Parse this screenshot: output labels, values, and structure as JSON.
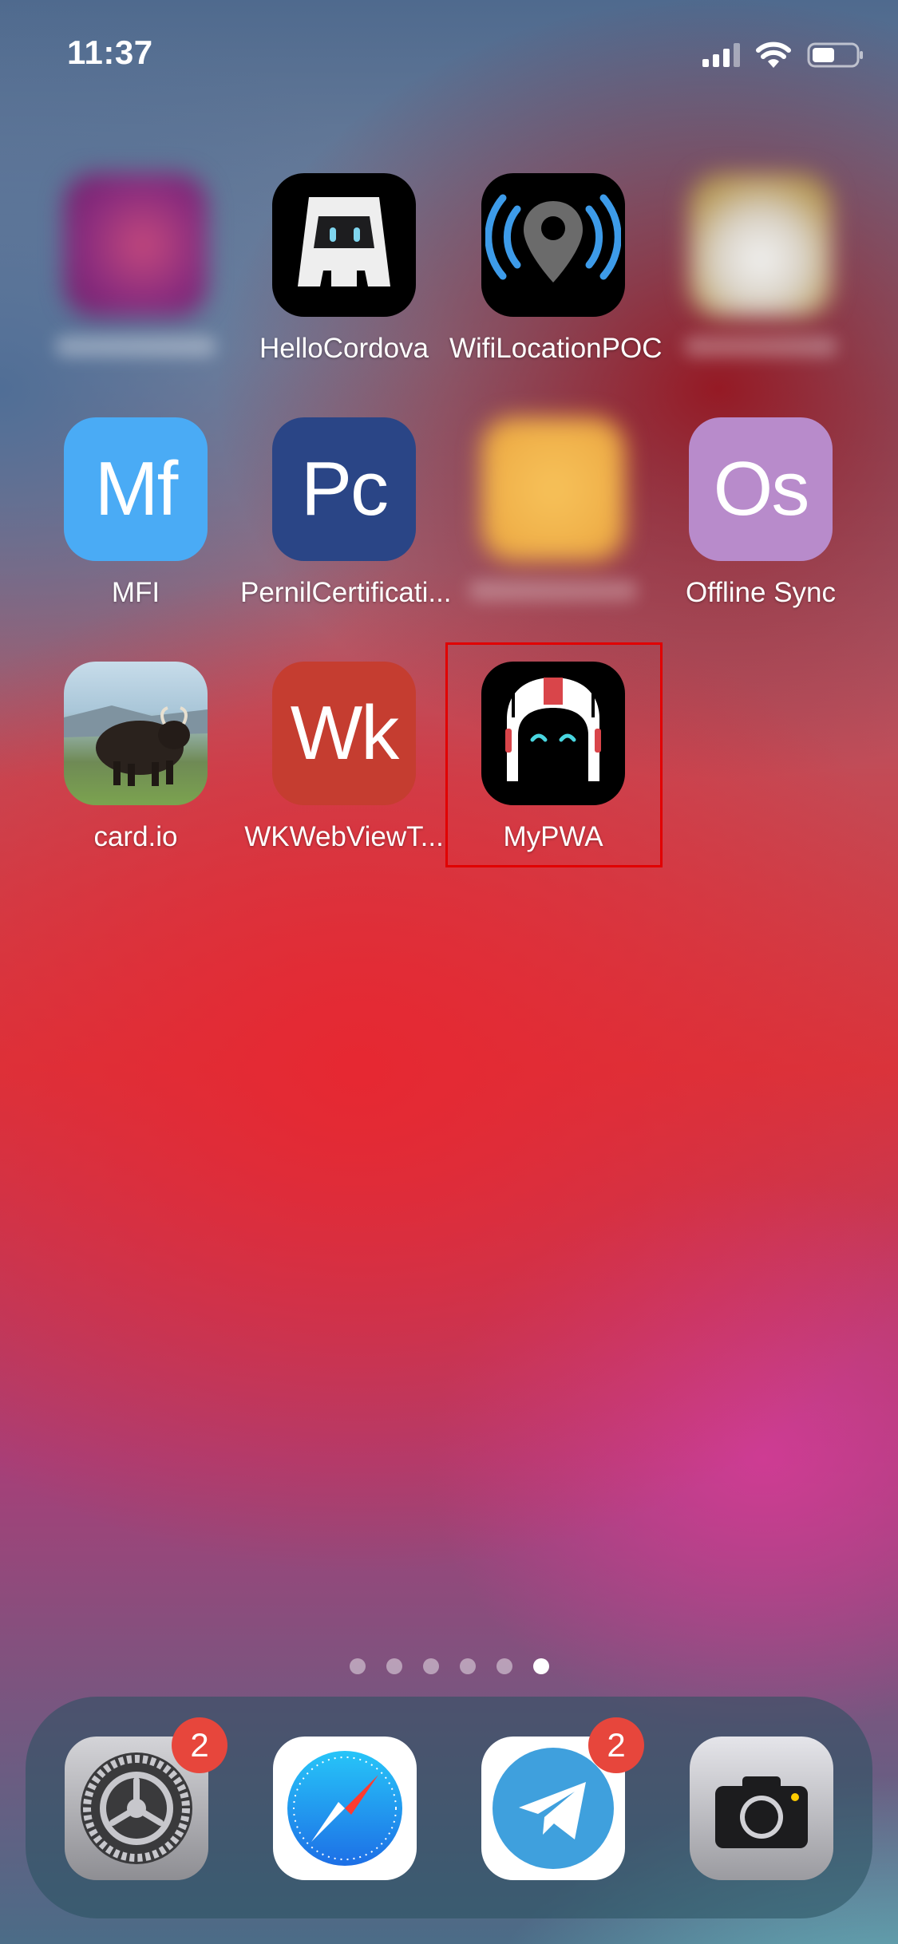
{
  "status_bar": {
    "time": "11:37"
  },
  "home_screen": {
    "apps": [
      {
        "label": "HelloCordova",
        "icon": "cordova-icon"
      },
      {
        "label": "WifiLocationPOC",
        "icon": "location-pin-icon"
      },
      {
        "label": "MFI",
        "icon_text": "Mf",
        "icon_color": "#4aabf5"
      },
      {
        "label": "PernilCertificati...",
        "icon_text": "Pc",
        "icon_color": "#2a4586"
      },
      {
        "label": "Offline Sync",
        "icon_text": "Os",
        "icon_color": "#b88bcb"
      },
      {
        "label": "card.io",
        "icon": "yak-photo-icon"
      },
      {
        "label": "WKWebViewT...",
        "icon_text": "Wk",
        "icon_color": "#c53d30"
      },
      {
        "label": "MyPWA",
        "icon": "astronaut-helmet-icon",
        "highlighted": true
      }
    ]
  },
  "page_indicator": {
    "pages": 6,
    "current_page": 6
  },
  "dock": {
    "apps": [
      {
        "name": "Settings",
        "icon": "settings-gear-icon",
        "badge": "2"
      },
      {
        "name": "Safari",
        "icon": "safari-compass-icon"
      },
      {
        "name": "Telegram",
        "icon": "telegram-paper-plane-icon",
        "badge": "2"
      },
      {
        "name": "Camera",
        "icon": "camera-icon"
      }
    ]
  },
  "colors": {
    "highlight_border": "#e10000",
    "badge": "#e7463c"
  }
}
